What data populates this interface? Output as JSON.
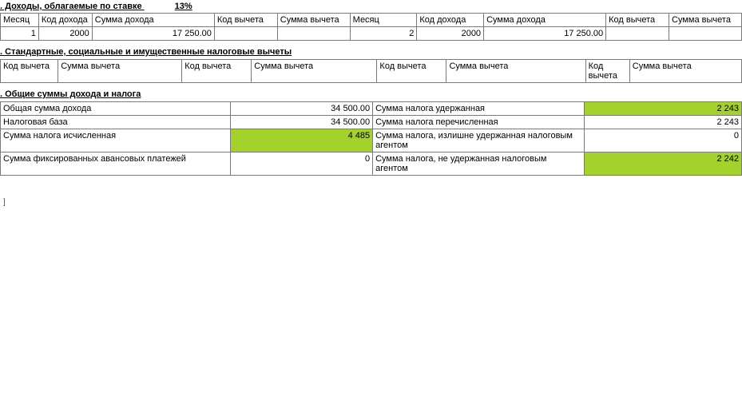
{
  "section3": {
    "title_prefix": ". Доходы, облагаемые по ставке",
    "rate": "13%",
    "headers": {
      "month": "Месяц",
      "income_code": "Код дохода",
      "income_sum": "Сумма дохода",
      "ded_code": "Код вычета",
      "ded_sum": "Сумма вычета"
    },
    "rows_left": [
      {
        "month": "1",
        "income_code": "2000",
        "income_sum": "17 250.00",
        "ded_code": "",
        "ded_sum": ""
      }
    ],
    "rows_right": [
      {
        "month": "2",
        "income_code": "2000",
        "income_sum": "17 250.00",
        "ded_code": "",
        "ded_sum": ""
      }
    ]
  },
  "section4": {
    "title": ". Стандартные, социальные и имущественные налоговые вычеты",
    "headers": {
      "code": "Код вычета",
      "sum": "Сумма вычета",
      "code_multi": "Код вычета"
    }
  },
  "section5": {
    "title": ". Общие суммы дохода и налога",
    "rows": [
      {
        "l_label": "Общая сумма дохода",
        "l_value": "34 500.00",
        "l_hl": false,
        "r_label": "Сумма налога удержанная",
        "r_value": "2 243",
        "r_hl": true
      },
      {
        "l_label": "Налоговая база",
        "l_value": "34 500.00",
        "l_hl": false,
        "r_label": "Сумма налога перечисленная",
        "r_value": "2 243",
        "r_hl": false
      },
      {
        "l_label": "Сумма налога исчисленная",
        "l_value": "4 485",
        "l_hl": true,
        "r_label": "Сумма налога, излишне удержанная налоговым агентом",
        "r_value": "0",
        "r_hl": false
      },
      {
        "l_label": "Сумма фиксированных авансовых платежей",
        "l_value": "0",
        "l_hl": false,
        "r_label": "Сумма налога, не удержанная налоговым агентом",
        "r_value": "2 242",
        "r_hl": true
      }
    ]
  },
  "stray_char": "]"
}
